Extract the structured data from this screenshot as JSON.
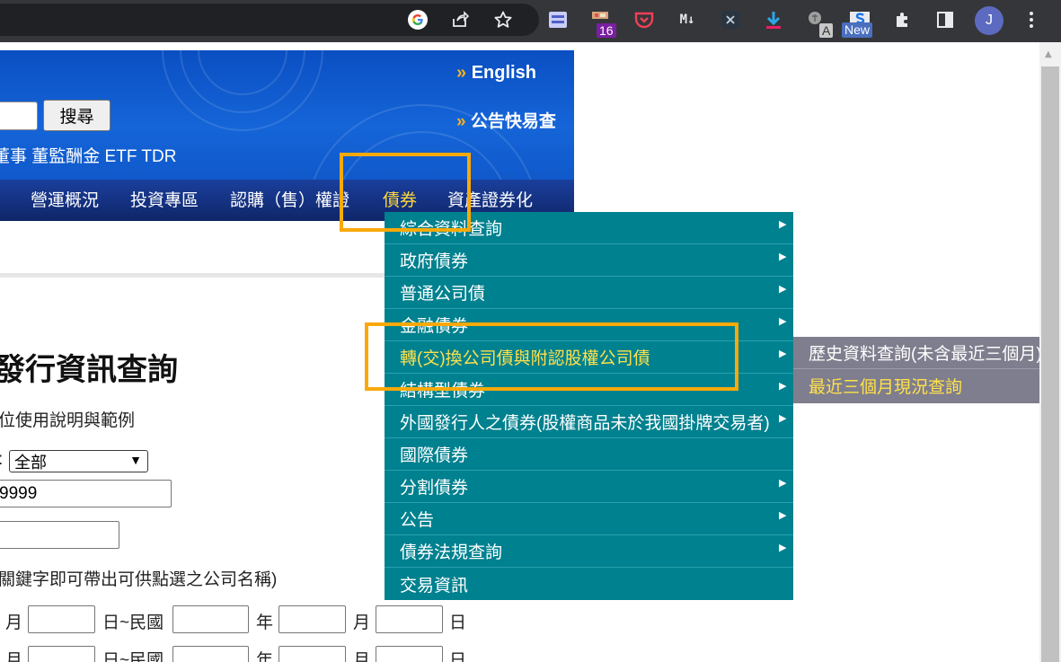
{
  "browser": {
    "ext_badge_count": "16",
    "ext_badge_new": "New",
    "ext_letter_a": "A",
    "avatar_initial": "J"
  },
  "header": {
    "english_link": "English",
    "quick_search_link": "公告快易查",
    "search_button": "搜尋",
    "links_row": "董事 董監酬金 ETF TDR",
    "search_value": ""
  },
  "nav": {
    "items": [
      "營運概況",
      "投資專區",
      "認購（售）權證",
      "債券",
      "資產證券化"
    ],
    "active": "債券"
  },
  "bond_menu": {
    "items": [
      {
        "label": "綜合資料查詢",
        "has_submenu": true
      },
      {
        "label": "政府債券",
        "has_submenu": true
      },
      {
        "label": "普通公司債",
        "has_submenu": true
      },
      {
        "label": "金融債券",
        "has_submenu": true
      },
      {
        "label": "轉(交)換公司債與附認股權公司債",
        "has_submenu": true
      },
      {
        "label": "結構型債券",
        "has_submenu": true
      },
      {
        "label": "外國發行人之債券(股權商品未於我國掛牌交易者)",
        "has_submenu": true
      },
      {
        "label": "國際債券",
        "has_submenu": false
      },
      {
        "label": "分割債券",
        "has_submenu": true
      },
      {
        "label": "公告",
        "has_submenu": true
      },
      {
        "label": "債券法規查詢",
        "has_submenu": true
      },
      {
        "label": "交易資訊",
        "has_submenu": false
      }
    ],
    "highlighted": "轉(交)換公司債與附認股權公司債",
    "submenu": [
      "歷史資料查詢(未含最近三個月)",
      "最近三個月現況查詢"
    ]
  },
  "form": {
    "title": "發行資訊查詢",
    "usage_link": "位使用說明與範例",
    "type_prefix": ":",
    "type_select": "全部",
    "code_value": "9999",
    "keyword_hint": "關鍵字即可帶出可供點選之公司名稱)",
    "date_labels": {
      "month": "月",
      "day_to_roc": "日~民國",
      "year": "年",
      "day": "日"
    }
  },
  "colors": {
    "menu_bg": "#00818f",
    "submenu_bg": "#7f7e8e",
    "highlight_text": "#ffe14a",
    "outline": "#f9a909",
    "banner_blue": "#1565d8"
  },
  "icons": [
    "google-icon",
    "share-icon",
    "star-icon",
    "reader-icon",
    "bookmark-ext-icon",
    "pocket-icon",
    "markdown-icon",
    "x-ext-icon",
    "download-icon",
    "translate-icon",
    "new-ext-icon",
    "puzzle-icon",
    "sidepanel-icon",
    "more-icon"
  ]
}
